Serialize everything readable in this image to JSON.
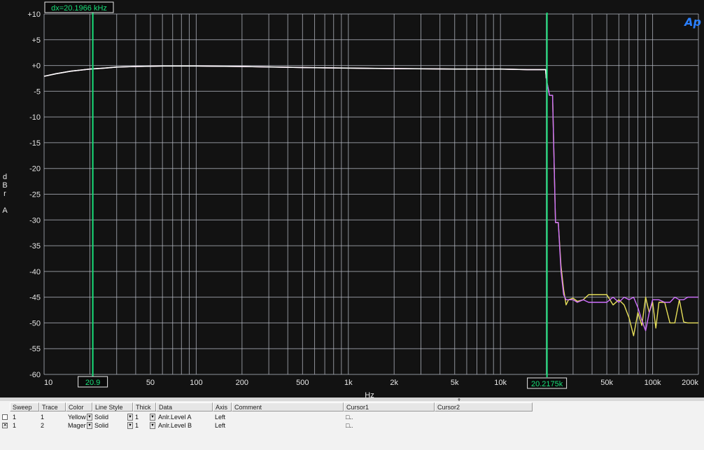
{
  "graph": {
    "y_unit_letters": [
      "d",
      "B",
      "r",
      "",
      "A"
    ],
    "x_unit": "Hz",
    "logo_text": "Ap",
    "colors": {
      "background": "#121212",
      "grid": "#b8bcc6",
      "cursor": "#19e07a",
      "trace_yellow": "#e8e05a",
      "trace_magenta": "#d070ff",
      "trace_white": "#ffffff"
    }
  },
  "cursors": {
    "delta_label": "dx=20.1966 kHz",
    "cursor1_label": "20.9",
    "cursor2_label": "20.2175k",
    "cursor1_hz": 20.9,
    "cursor2_hz": 20217.5
  },
  "chart_data": {
    "type": "line",
    "xlabel": "Hz",
    "ylabel": "dBr A",
    "xscale": "log",
    "xlim": [
      10,
      200000
    ],
    "ylim": [
      -60,
      10
    ],
    "grid": true,
    "yticks": [
      "+10",
      "+5",
      "+0",
      "-5",
      "-10",
      "-15",
      "-20",
      "-25",
      "-30",
      "-35",
      "-40",
      "-45",
      "-50",
      "-55",
      "-60"
    ],
    "ytick_values": [
      10,
      5,
      0,
      -5,
      -10,
      -15,
      -20,
      -25,
      -30,
      -35,
      -40,
      -45,
      -50,
      -55,
      -60
    ],
    "xticks": [
      "10",
      "20",
      "50",
      "100",
      "200",
      "500",
      "1k",
      "2k",
      "5k",
      "10k",
      "20k",
      "50k",
      "100k",
      "200k"
    ],
    "xtick_values": [
      10,
      20,
      50,
      100,
      200,
      500,
      1000,
      2000,
      5000,
      10000,
      20000,
      50000,
      100000,
      200000
    ],
    "series": [
      {
        "color": "#e8e05a",
        "x": [
          10,
          12,
          15,
          20,
          25,
          30,
          40,
          60,
          100,
          200,
          500,
          1000,
          2000,
          5000,
          10000,
          15000,
          18000,
          19800,
          20000,
          21000,
          22000,
          23000,
          24000,
          25000,
          26000,
          27000,
          28000,
          30000,
          32000,
          35000,
          38000,
          42000,
          46000,
          50000,
          55000,
          60000,
          65000,
          70000,
          75000,
          80000,
          85000,
          90000,
          95000,
          100000,
          105000,
          110000,
          120000,
          130000,
          140000,
          150000,
          160000,
          170000,
          180000,
          190000,
          200000
        ],
        "y": [
          -2.1,
          -1.6,
          -1.1,
          -0.7,
          -0.5,
          -0.3,
          -0.2,
          -0.1,
          -0.1,
          -0.2,
          -0.4,
          -0.5,
          -0.6,
          -0.7,
          -0.7,
          -0.8,
          -0.8,
          -0.8,
          -2.5,
          -5.8,
          -5.8,
          -30.5,
          -30.5,
          -39,
          -43.5,
          -46.5,
          -45.5,
          -45.2,
          -45.8,
          -45.5,
          -44.5,
          -44.5,
          -44.5,
          -44.5,
          -46.5,
          -45.5,
          -46.5,
          -49,
          -52.5,
          -48,
          -50.5,
          -45,
          -48,
          -46,
          -51,
          -46,
          -46,
          -50,
          -50,
          -45.5,
          -49.8,
          -50,
          -50,
          -50,
          -50
        ]
      },
      {
        "color": "#d070ff",
        "x": [
          10,
          12,
          15,
          20,
          25,
          30,
          40,
          60,
          100,
          200,
          500,
          1000,
          2000,
          5000,
          10000,
          15000,
          18000,
          19800,
          20000,
          21000,
          22000,
          23000,
          24000,
          25000,
          26000,
          27000,
          28000,
          30000,
          32000,
          35000,
          38000,
          42000,
          46000,
          50000,
          55000,
          60000,
          65000,
          70000,
          75000,
          80000,
          85000,
          90000,
          95000,
          100000,
          105000,
          110000,
          120000,
          130000,
          140000,
          150000,
          160000,
          170000,
          180000,
          190000,
          200000
        ],
        "y": [
          -2.1,
          -1.6,
          -1.1,
          -0.7,
          -0.5,
          -0.3,
          -0.2,
          -0.1,
          -0.1,
          -0.2,
          -0.4,
          -0.5,
          -0.6,
          -0.7,
          -0.7,
          -0.8,
          -0.8,
          -0.8,
          -2.5,
          -5.8,
          -5.8,
          -30.5,
          -30.5,
          -40,
          -44.5,
          -45.5,
          -45.5,
          -45.5,
          -46,
          -45.5,
          -46,
          -46,
          -46,
          -46,
          -45,
          -46,
          -45,
          -45.5,
          -45,
          -47,
          -49.5,
          -51.5,
          -48,
          -45.5,
          -45.5,
          -45.5,
          -46,
          -46,
          -45,
          -45.5,
          -45.5,
          -45,
          -45,
          -45,
          -45
        ]
      },
      {
        "color": "#ffffff",
        "x": [
          10,
          12,
          15,
          20,
          25,
          30,
          40,
          60,
          100,
          200,
          500,
          1000,
          2000,
          5000,
          10000,
          15000,
          18000,
          19800,
          20000
        ],
        "y": [
          -2.1,
          -1.6,
          -1.1,
          -0.7,
          -0.5,
          -0.3,
          -0.2,
          -0.1,
          -0.1,
          -0.2,
          -0.4,
          -0.5,
          -0.6,
          -0.7,
          -0.7,
          -0.8,
          -0.8,
          -0.8,
          -2.5
        ]
      }
    ]
  },
  "table": {
    "headers": [
      "Sweep",
      "Trace",
      "Color",
      "Line Style",
      "Thick",
      "Data",
      "Axis",
      "Comment",
      "Cursor1",
      "Cursor2"
    ],
    "rows": [
      {
        "checked": false,
        "sweep": "1",
        "trace": "1",
        "color": "Yellow",
        "line_style": "Solid",
        "thick": "1",
        "data": "Anlr.Level A",
        "axis": "Left",
        "comment": "",
        "cursor1": "□..",
        "cursor2": ""
      },
      {
        "checked": true,
        "sweep": "1",
        "trace": "2",
        "color": "Magenta",
        "line_style": "Solid",
        "thick": "1",
        "data": "Anlr.Level B",
        "axis": "Left",
        "comment": "",
        "cursor1": "□..",
        "cursor2": ""
      }
    ]
  }
}
